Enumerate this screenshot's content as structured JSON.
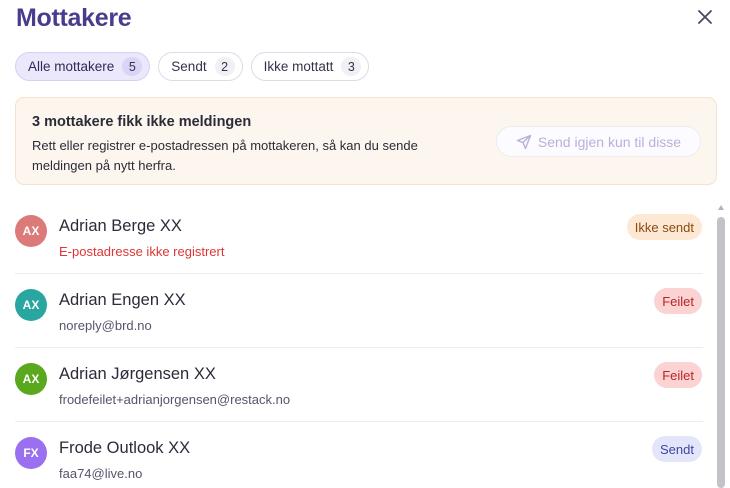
{
  "header": {
    "title": "Mottakere",
    "close_icon": "close-icon"
  },
  "tabs": [
    {
      "label": "Alle mottakere",
      "count": "5",
      "active": true
    },
    {
      "label": "Sendt",
      "count": "2",
      "active": false
    },
    {
      "label": "Ikke mottatt",
      "count": "3",
      "active": false
    }
  ],
  "banner": {
    "title": "3 mottakere fikk ikke meldingen",
    "text": "Rett eller registrer e-postadressen på mottakeren, så kan du sende meldingen på nytt herfra.",
    "resend_label": "Send igjen kun til disse",
    "resend_icon": "send-icon"
  },
  "recipients": [
    {
      "initials": "AX",
      "name": "Adrian Berge XX",
      "detail": "E-postadresse ikke registrert",
      "detail_is_error": true,
      "status": "Ikke sendt",
      "avatar_color": "#dc7a7a",
      "status_bg": "#fde9d3",
      "status_fg": "#8a4a12"
    },
    {
      "initials": "AX",
      "name": "Adrian Engen XX",
      "detail": "noreply@brd.no",
      "detail_is_error": false,
      "status": "Feilet",
      "avatar_color": "#2aa6a0",
      "status_bg": "#fbd3d3",
      "status_fg": "#b82525"
    },
    {
      "initials": "AX",
      "name": "Adrian Jørgensen XX",
      "detail": "frodefeilet+adrianjorgensen@restack.no",
      "detail_is_error": false,
      "status": "Feilet",
      "avatar_color": "#5aa81e",
      "status_bg": "#fbd3d3",
      "status_fg": "#b82525"
    },
    {
      "initials": "FX",
      "name": "Frode Outlook XX",
      "detail": "faa74@live.no",
      "detail_is_error": false,
      "status": "Sendt",
      "avatar_color": "#9a6ff0",
      "status_bg": "#e3e6fb",
      "status_fg": "#3f47a0"
    }
  ],
  "colors": {
    "title": "#4a3b8c",
    "error": "#e03535"
  }
}
